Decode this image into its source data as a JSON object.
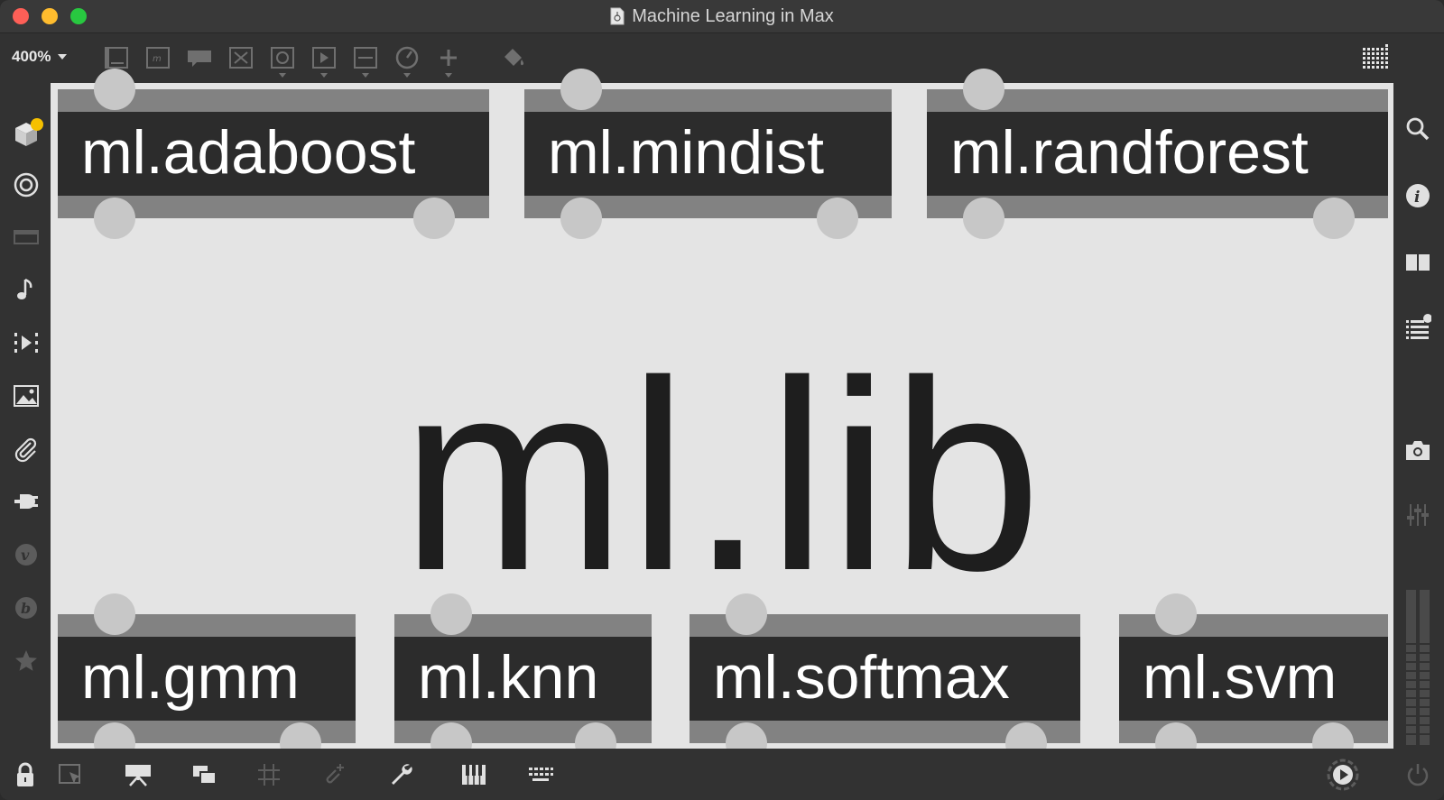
{
  "window": {
    "title": "Machine Learning in Max"
  },
  "toolbar": {
    "zoom_label": "400%",
    "icons": [
      "newobject-icon",
      "message-icon",
      "comment-icon",
      "toggle-icon",
      "button-icon",
      "playbar-icon",
      "slider-icon",
      "dial-icon",
      "add-icon",
      "paint-bucket-icon",
      "grid-view-icon"
    ]
  },
  "canvas": {
    "title": "ml.lib",
    "top_row": [
      "ml.adaboost",
      "ml.mindist",
      "ml.randforest"
    ],
    "bottom_row": [
      "ml.gmm",
      "ml.knn",
      "ml.softmax",
      "ml.svm"
    ]
  },
  "colors": {
    "canvas_bg": "#e4e4e4",
    "object_bg": "#2c2c2c",
    "object_bar": "#828282",
    "port": "#c7c7c7",
    "notification_dot": "#f5c000"
  }
}
